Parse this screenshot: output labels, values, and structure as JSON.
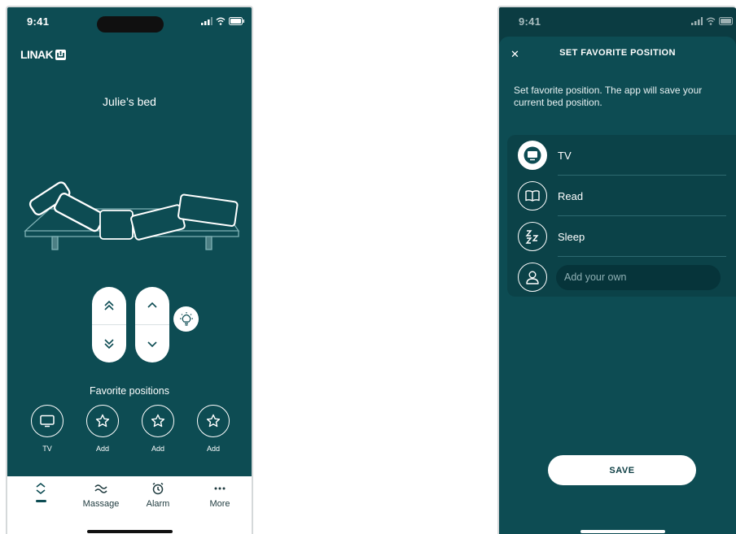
{
  "left_screen": {
    "status_time": "9:41",
    "brand": "LINAK",
    "bed_name": "Julie’s bed",
    "favorites_title": "Favorite positions",
    "favorites": [
      {
        "label": "TV",
        "icon": "tv-icon"
      },
      {
        "label": "Add",
        "icon": "star-icon"
      },
      {
        "label": "Add",
        "icon": "star-icon"
      },
      {
        "label": "Add",
        "icon": "star-icon"
      }
    ],
    "tabs": [
      {
        "label": "",
        "icon": "chevron-up-down-icon",
        "active": true
      },
      {
        "label": "Massage",
        "icon": "waves-icon"
      },
      {
        "label": "Alarm",
        "icon": "alarm-clock-icon"
      },
      {
        "label": "More",
        "icon": "more-dots-icon"
      }
    ],
    "colors": {
      "background": "#0d4c53",
      "tab_bar": "#ffffff"
    }
  },
  "right_screen": {
    "status_time": "9:41",
    "close_glyph": "✕",
    "title": "SET FAVORITE POSITION",
    "description": "Set favorite position. The app will save your current bed position.",
    "positions": [
      {
        "label": "TV",
        "icon": "tv-icon",
        "selected": true
      },
      {
        "label": "Read",
        "icon": "book-icon"
      },
      {
        "label": "Sleep",
        "icon": "zzz-icon"
      }
    ],
    "custom_placeholder": "Add your own",
    "custom_icon": "person-icon",
    "save_label": "SAVE",
    "colors": {
      "background": "#0b3c42",
      "sheet": "#0d4c53"
    }
  }
}
